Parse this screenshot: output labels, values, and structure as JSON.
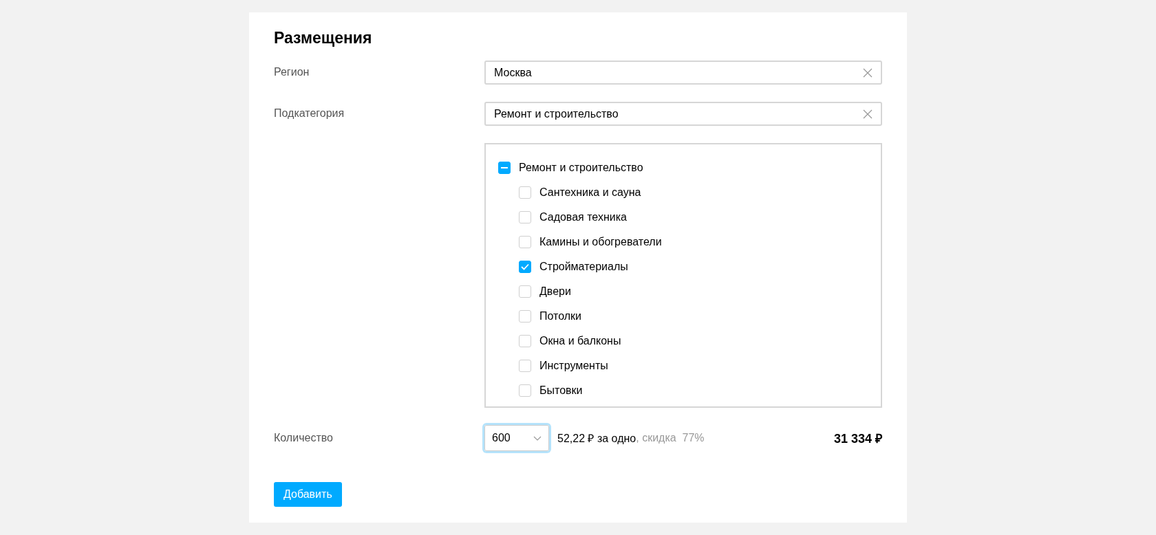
{
  "title": "Размещения",
  "region": {
    "label": "Регион",
    "value": "Москва"
  },
  "subcategory": {
    "label": "Подкатегория",
    "value": "Ремонт и строительство"
  },
  "tree": [
    {
      "label": "Ремонт и строительство",
      "indeterminate": true,
      "children": [
        {
          "label": "Сантехника и сауна",
          "checked": false
        },
        {
          "label": "Садовая техника",
          "checked": false
        },
        {
          "label": "Камины и обогреватели",
          "checked": false
        },
        {
          "label": "Стройматериалы",
          "checked": true
        },
        {
          "label": "Двери",
          "checked": false
        },
        {
          "label": "Потолки",
          "checked": false
        },
        {
          "label": "Окна и балконы",
          "checked": false
        },
        {
          "label": "Инструменты",
          "checked": false
        },
        {
          "label": "Бытовки",
          "checked": false
        }
      ]
    }
  ],
  "quantity": {
    "label": "Количество",
    "value": "600",
    "focused": true,
    "unit_price": "52,22 ₽ за одно",
    "discount": ", скидка  77%",
    "total": "31 334 ₽"
  },
  "add_button": "Добавить"
}
